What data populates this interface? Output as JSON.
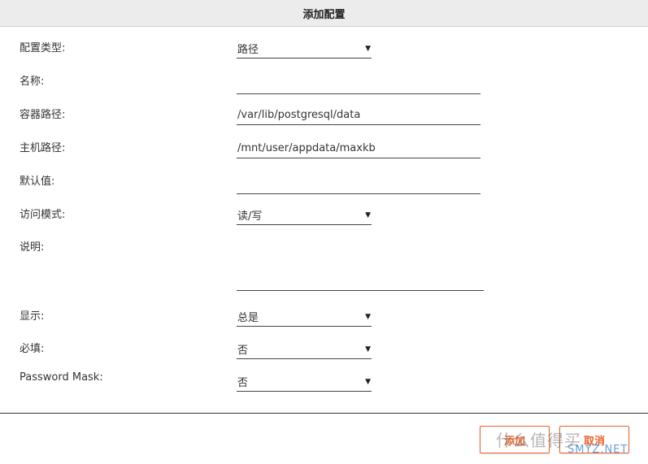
{
  "dialog": {
    "title": "添加配置"
  },
  "fields": [
    {
      "label": "配置类型:",
      "type": "select",
      "value": "路径"
    },
    {
      "label": "名称:",
      "type": "text",
      "value": ""
    },
    {
      "label": "容器路径:",
      "type": "text",
      "value": "/var/lib/postgresql/data"
    },
    {
      "label": "主机路径:",
      "type": "text",
      "value": "/mnt/user/appdata/maxkb"
    },
    {
      "label": "默认值:",
      "type": "text",
      "value": ""
    },
    {
      "label": "访问模式:",
      "type": "select",
      "value": "读/写"
    },
    {
      "label": "说明:",
      "type": "textarea",
      "value": ""
    },
    {
      "label": "显示:",
      "type": "select",
      "value": "总是"
    },
    {
      "label": "必填:",
      "type": "select",
      "value": "否"
    },
    {
      "label": "Password Mask:",
      "type": "select",
      "value": "否"
    }
  ],
  "buttons": {
    "add": "添加",
    "cancel": "取消"
  },
  "watermark": {
    "text": "什么值得买",
    "sub": "SMYZ.NET"
  },
  "icons": {
    "select_caret": "caret-down-icon"
  }
}
